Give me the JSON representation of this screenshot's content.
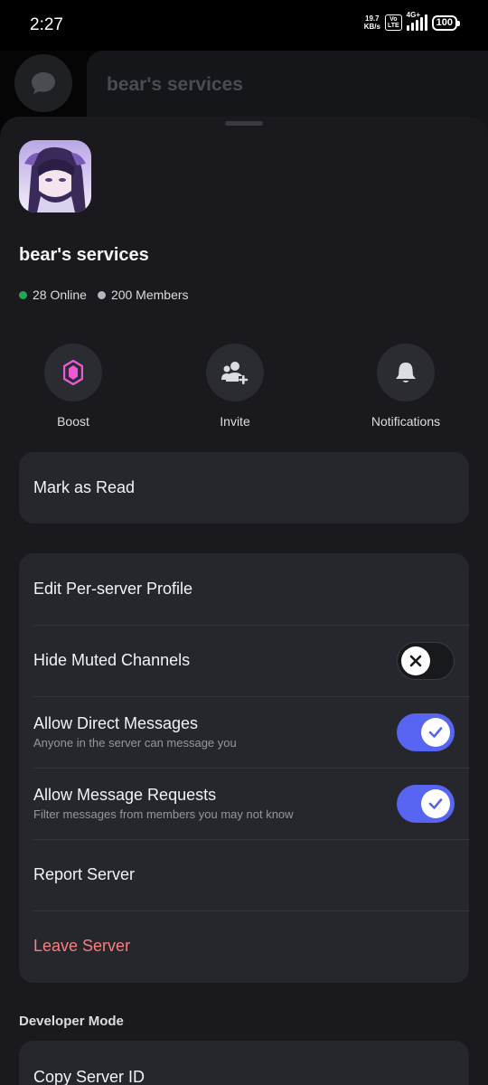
{
  "status_bar": {
    "time": "2:27",
    "net_speed_value": "19.7",
    "net_speed_unit": "KB/s",
    "volte_top": "Vo",
    "volte_bottom": "LTE",
    "signal_type": "4G+",
    "battery": "100"
  },
  "background": {
    "server_title": "bear's services"
  },
  "server": {
    "name": "bear's services",
    "online": "28 Online",
    "members": "200 Members",
    "online_color": "#23a55a",
    "members_color": "#b5b6bc"
  },
  "actions": [
    {
      "label": "Boost",
      "icon": "boost-gem-icon"
    },
    {
      "label": "Invite",
      "icon": "add-user-icon"
    },
    {
      "label": "Notifications",
      "icon": "bell-icon"
    }
  ],
  "menu": {
    "mark_as_read": "Mark as Read",
    "edit_profile": "Edit Per-server Profile",
    "hide_muted": {
      "label": "Hide Muted Channels",
      "enabled": false
    },
    "allow_dms": {
      "label": "Allow Direct Messages",
      "sub": "Anyone in the server can message you",
      "enabled": true
    },
    "allow_requests": {
      "label": "Allow Message Requests",
      "sub": "Filter messages from members you may not know",
      "enabled": true
    },
    "report": "Report Server",
    "leave": "Leave Server"
  },
  "developer": {
    "section_label": "Developer Mode",
    "copy_id": "Copy Server ID"
  },
  "colors": {
    "accent": "#5865f2",
    "danger": "#f77f7f",
    "boost": "#eb59d6"
  }
}
